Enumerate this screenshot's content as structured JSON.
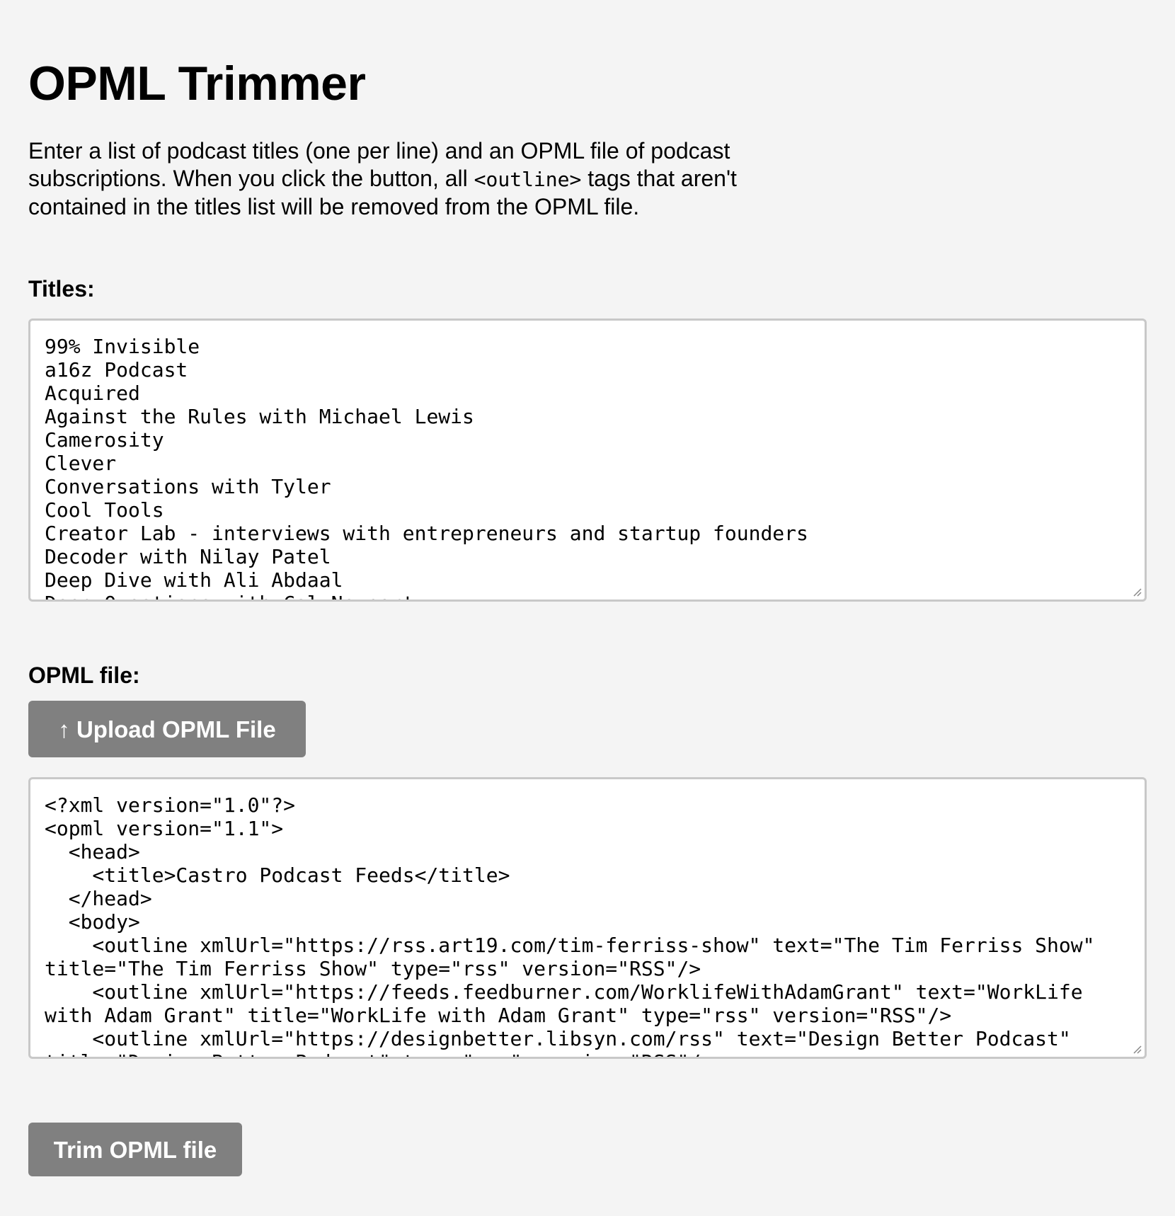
{
  "page": {
    "title": "OPML Trimmer",
    "intro_before": "Enter a list of podcast titles (one per line) and an OPML file of podcast subscriptions. When you click the button, all ",
    "intro_code": "<outline>",
    "intro_after": " tags that aren't contained in the titles list will be removed from the OPML file."
  },
  "titles_section": {
    "label": "Titles:",
    "lines": [
      "99% Invisible",
      "a16z Podcast",
      "Acquired",
      "Against the Rules with Michael Lewis",
      "Camerosity",
      "Clever",
      "Conversations with Tyler",
      "Cool Tools",
      "Creator Lab - interviews with entrepreneurs and startup founders",
      "Decoder with Nilay Patel",
      "Deep Dive with Ali Abdaal",
      "Deep Questions with Cal Newport"
    ]
  },
  "opml_section": {
    "label": "OPML file:",
    "upload_button_label": "↑ Upload OPML File",
    "lines": [
      "<?xml version=\"1.0\"?>",
      "<opml version=\"1.1\">",
      "  <head>",
      "    <title>Castro Podcast Feeds</title>",
      "  </head>",
      "  <body>",
      "    <outline xmlUrl=\"https://rss.art19.com/tim-ferriss-show\" text=\"The Tim Ferriss Show\"",
      "title=\"The Tim Ferriss Show\" type=\"rss\" version=\"RSS\"/>",
      "    <outline xmlUrl=\"https://feeds.feedburner.com/WorklifeWithAdamGrant\" text=\"WorkLife",
      "with Adam Grant\" title=\"WorkLife with Adam Grant\" type=\"rss\" version=\"RSS\"/>",
      "    <outline xmlUrl=\"https://designbetter.libsyn.com/rss\" text=\"Design Better Podcast\"",
      "title=\"Design Better Podcast\" type=\"rss\" version=\"RSS\"/>"
    ]
  },
  "actions": {
    "trim_button_label": "Trim OPML file"
  },
  "colors": {
    "background": "#f4f4f4",
    "button": "#808080",
    "textarea_border": "#c8c8c8",
    "spellcheck": "#d9534f"
  }
}
